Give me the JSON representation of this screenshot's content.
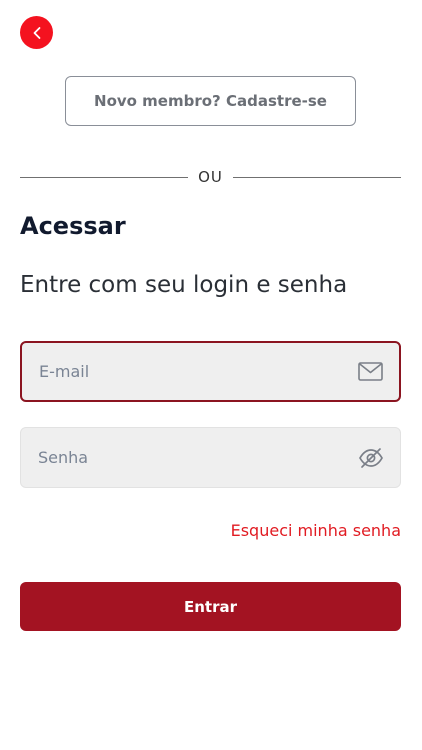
{
  "header": {
    "back_icon": "chevron-left-icon",
    "back_color": "#f4121f"
  },
  "signup": {
    "label": "Novo membro? Cadastre-se"
  },
  "divider": {
    "label": "OU"
  },
  "login": {
    "title": "Acessar",
    "subtitle": "Entre com seu login e senha",
    "email": {
      "value": "",
      "placeholder": "E-mail",
      "icon": "mail-icon"
    },
    "password": {
      "value": "",
      "placeholder": "Senha",
      "icon": "eye-off-icon"
    },
    "forgot_label": "Esqueci minha senha",
    "submit_label": "Entrar"
  },
  "colors": {
    "primary": "#a31322",
    "accent_red": "#e11b22",
    "active_border": "#8b1420",
    "field_bg": "#efefef"
  }
}
